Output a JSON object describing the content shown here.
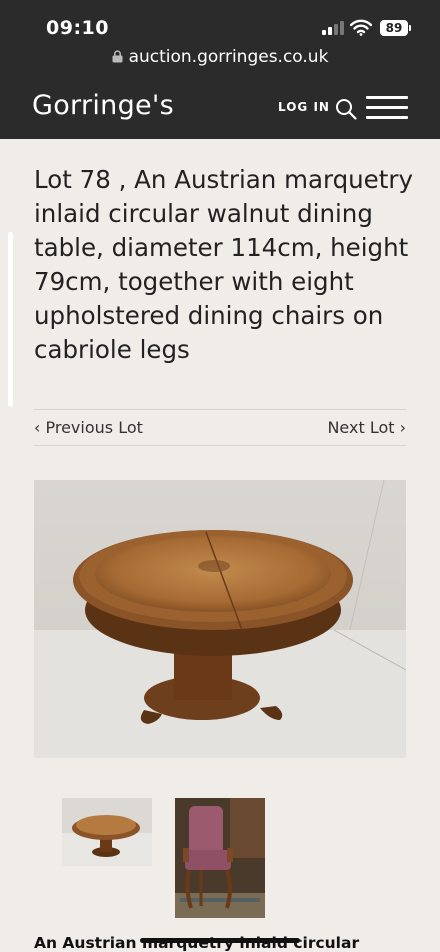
{
  "status": {
    "time": "09:10",
    "battery": "89"
  },
  "browser": {
    "url": "auction.gorringes.co.uk"
  },
  "header": {
    "logo": "Gorringe's",
    "login_label": "LOG IN"
  },
  "lot": {
    "title": "Lot 78 , An Austrian marquetry inlaid circular walnut dining table, diameter 114cm, height 79cm, together with eight upholstered dining chairs on cabriole legs",
    "prev_label": "‹ Previous Lot",
    "next_label": "Next Lot ›",
    "description_heading": "An Austrian marquetry inlaid circular"
  },
  "icons": [
    "lock-icon",
    "signal-icon",
    "wifi-icon",
    "battery-icon",
    "search-icon",
    "menu-icon"
  ],
  "colors": {
    "header_bg": "#2b2b2b",
    "page_bg": "#f0ede8",
    "text": "#222222"
  }
}
